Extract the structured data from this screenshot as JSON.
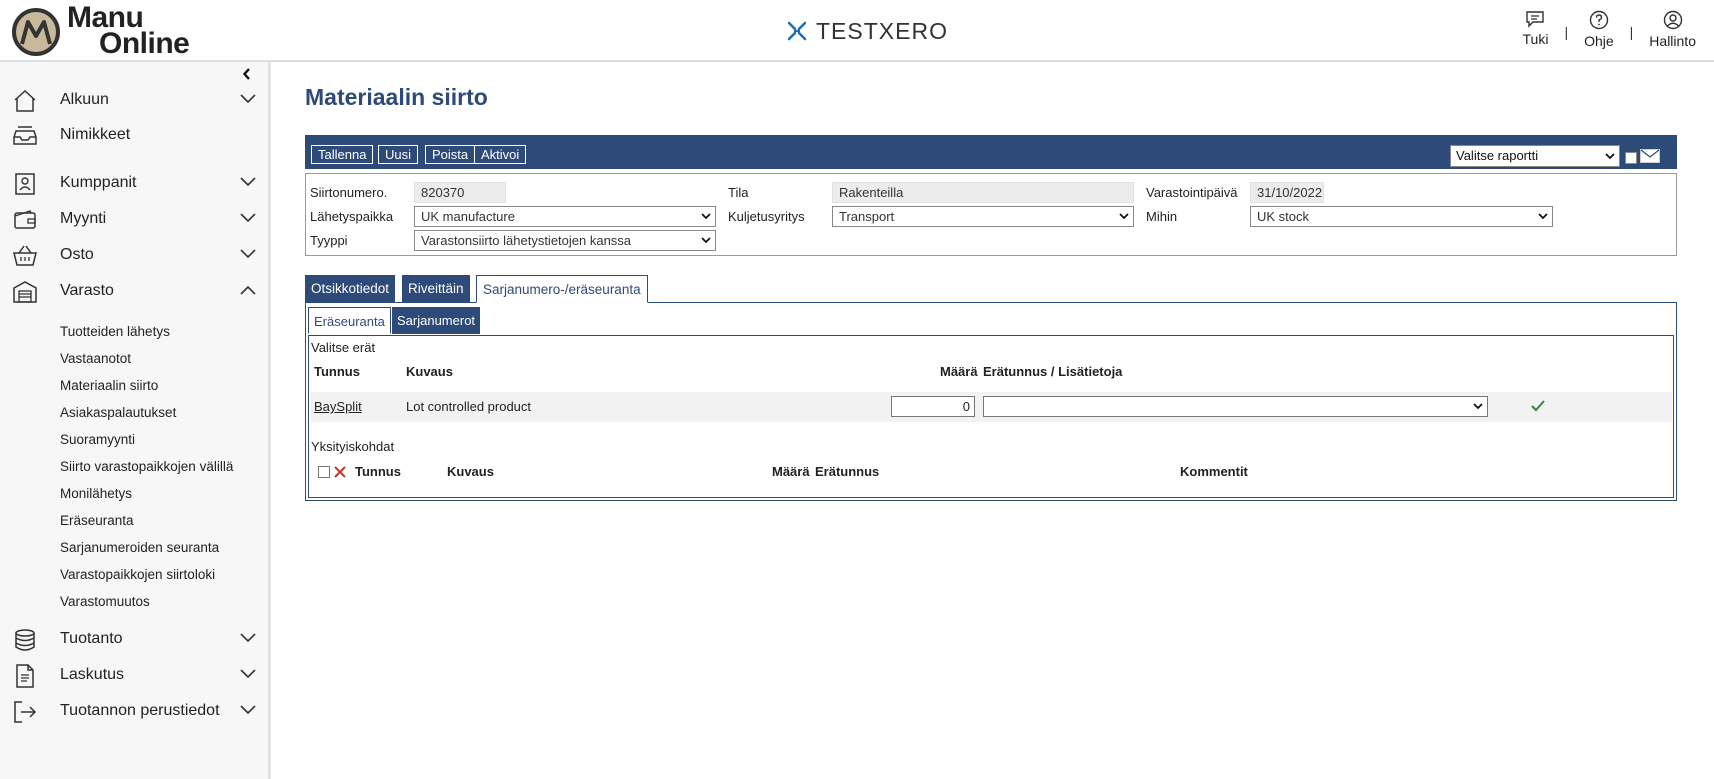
{
  "header": {
    "logo_line1": "Manu",
    "logo_line2": "Online",
    "company": "TESTXERO",
    "links": {
      "support": "Tuki",
      "help": "Ohje",
      "admin": "Hallinto"
    },
    "separator": "|"
  },
  "sidebar": {
    "items": {
      "home": "Alkuun",
      "items": "Nimikkeet",
      "partners": "Kumppanit",
      "sales": "Myynti",
      "purchase": "Osto",
      "inventory": "Varasto",
      "production": "Tuotanto",
      "invoicing": "Laskutus",
      "basic_data": "Tuotannon perustiedot"
    },
    "inventory_sub": [
      "Tuotteiden lähetys",
      "Vastaanotot",
      "Materiaalin siirto",
      "Asiakaspalautukset",
      "Suoramyynti",
      "Siirto varastopaikkojen välillä",
      "Monilähetys",
      "Eräseuranta",
      "Sarjanumeroiden seuranta",
      "Varastopaikkojen siirtoloki",
      "Varastomuutos"
    ]
  },
  "page": {
    "title": "Materiaalin siirto"
  },
  "toolbar": {
    "save": "Tallenna",
    "new": "Uusi",
    "delete": "Poista",
    "activate": "Aktivoi",
    "report_placeholder": "Valitse raportti"
  },
  "form": {
    "transfer_no_label": "Siirtonumero.",
    "transfer_no": "820370",
    "status_label": "Tila",
    "status": "Rakenteilla",
    "storage_date_label": "Varastointipäivä",
    "storage_date": "31/10/2022",
    "ship_from_label": "Lähetyspaikka",
    "ship_from": "UK manufacture",
    "carrier_label": "Kuljetusyritys",
    "carrier": "Transport",
    "ship_to_label": "Mihin",
    "ship_to": "UK stock",
    "type_label": "Tyyppi",
    "type": "Varastonsiirto lähetystietojen kanssa"
  },
  "tabs": {
    "header_info": "Otsikkotiedot",
    "by_row": "Riveittäin",
    "serial_lot": "Sarjanumero-/eräseuranta"
  },
  "inner_tabs": {
    "lot_tracking": "Eräseuranta",
    "serial_numbers": "Sarjanumerot"
  },
  "lots": {
    "select_label": "Valitse erät",
    "columns": {
      "id": "Tunnus",
      "description": "Kuvaus",
      "qty": "Määrä",
      "lot_info": "Erätunnus / Lisätietoja"
    },
    "rows": [
      {
        "id": "BaySplit",
        "description": "Lot controlled product",
        "qty": "0",
        "lot": ""
      }
    ]
  },
  "details": {
    "label": "Yksityiskohdat",
    "columns": {
      "id": "Tunnus",
      "description": "Kuvaus",
      "qty": "Määrä",
      "lot": "Erätunnus",
      "comments": "Kommentit"
    }
  },
  "colors": {
    "primary": "#2e4a78",
    "accent_blue": "#1f6fb5",
    "confirm_green": "#2e8b3a",
    "delete_red": "#c0392b"
  }
}
